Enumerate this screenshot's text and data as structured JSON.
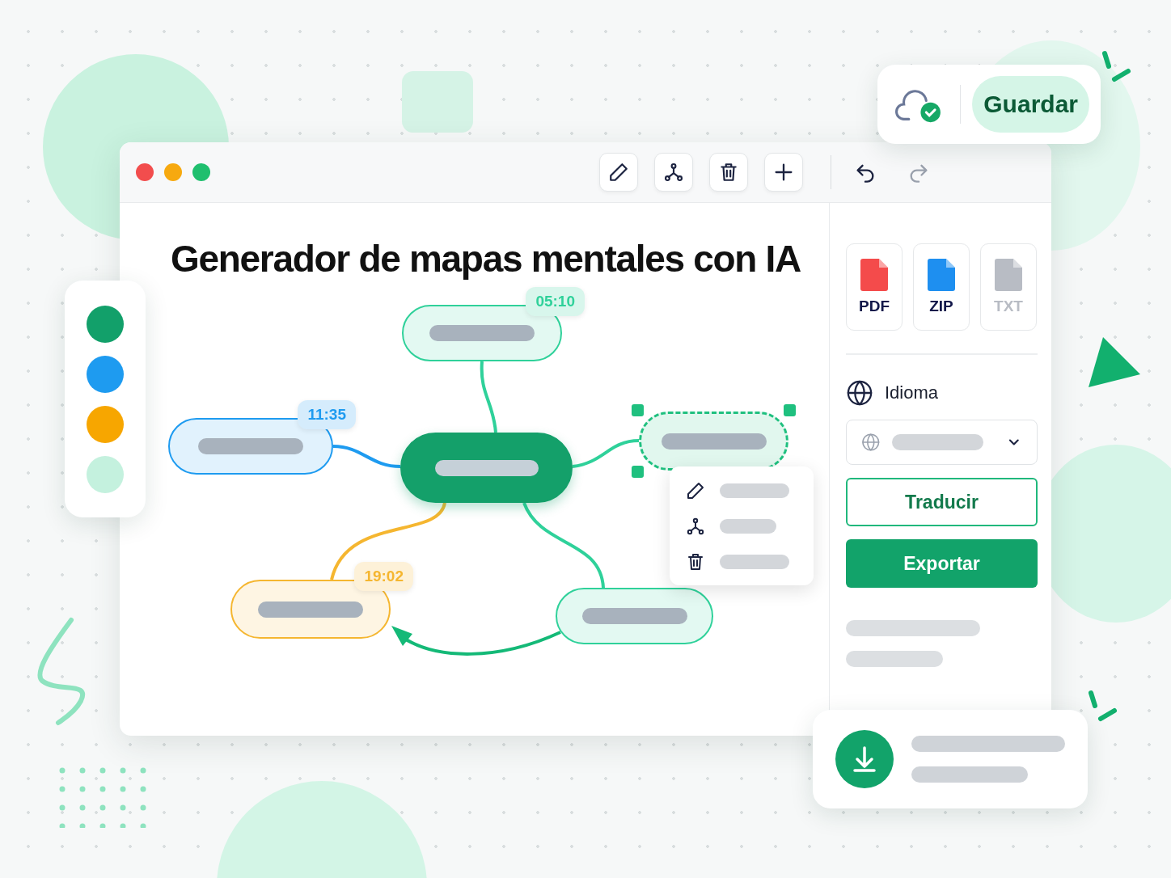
{
  "save_card": {
    "label": "Guardar",
    "synced": true
  },
  "title": "Generador de mapas mentales con IA",
  "palette": [
    {
      "color": "#12a06a"
    },
    {
      "color": "#1e9bf0"
    },
    {
      "color": "#f7a600"
    },
    {
      "color": "#c4f1de"
    }
  ],
  "nodes": [
    {
      "kind": "branch",
      "color": "#2fd19a",
      "time": "05:10",
      "selected": false
    },
    {
      "kind": "branch",
      "color": "#1e9bf0",
      "time": "11:35",
      "selected": false
    },
    {
      "kind": "central",
      "color": "#14a06a",
      "selected": false
    },
    {
      "kind": "branch",
      "color": "#1fc07f",
      "selected": true
    },
    {
      "kind": "branch",
      "color": "#f5b630",
      "time": "19:02",
      "selected": false
    },
    {
      "kind": "branch",
      "color": "#2fd19a",
      "selected": false
    }
  ],
  "exports": [
    {
      "label": "PDF",
      "color": "#f44b4b",
      "disabled": false
    },
    {
      "label": "ZIP",
      "color": "#1e8ff0",
      "disabled": false
    },
    {
      "label": "TXT",
      "color": "#b8bcc4",
      "disabled": true
    }
  ],
  "language": {
    "label": "Idioma"
  },
  "buttons": [
    {
      "label": "Traducir",
      "kind": "outline"
    },
    {
      "label": "Exportar",
      "kind": "primary"
    }
  ]
}
